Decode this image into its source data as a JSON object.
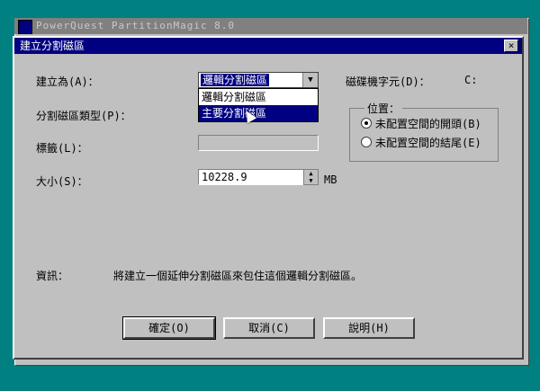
{
  "background_window": {
    "title": "PowerQuest PartitionMagic 8.0"
  },
  "dialog": {
    "title": "建立分割磁區",
    "close_label": "×",
    "create_as_label": "建立為(A)：",
    "create_as_selected": "邏輯分割磁區",
    "create_as_options": [
      "邏輯分割磁區",
      "主要分割磁區"
    ],
    "drive_letter_label": "磁碟機字元(D)：",
    "drive_letter_value": "C:",
    "partition_type_label": "分割磁區類型(P)：",
    "label_label": "標籤(L)：",
    "label_value": "",
    "size_label": "大小(S)：",
    "size_value": "10228.9",
    "size_unit": "MB",
    "position_group": {
      "legend": "位置：",
      "options": [
        "未配置空間的開頭(B)",
        "未配置空間的結尾(E)"
      ],
      "selected_index": 0
    },
    "info_label": "資訊：",
    "info_text": "將建立一個延伸分割磁區來包住這個邏輯分割磁區。",
    "buttons": {
      "ok": "確定(O)",
      "cancel": "取消(C)",
      "help": "說明(H)"
    }
  }
}
